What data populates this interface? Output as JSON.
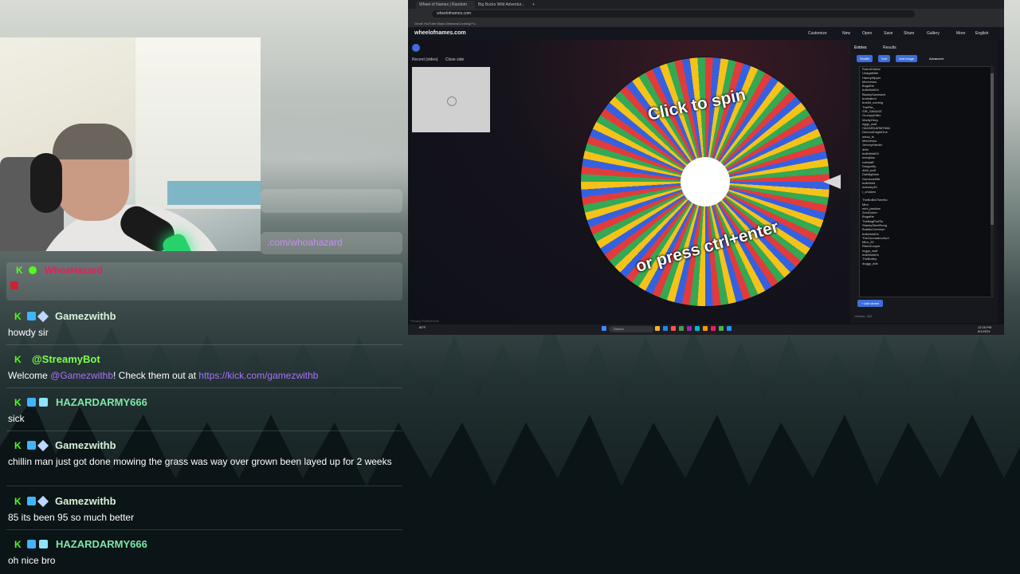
{
  "overlay": {
    "social_handle": ".com/whoahazard",
    "streamer_name": "WhoaHazard"
  },
  "chat": [
    {
      "user": "Gamezwithb",
      "user_color": "#d8f3d8",
      "text": "howdy sir"
    },
    {
      "user": "@StreamyBot",
      "user_color": "#7fff4f",
      "text_before": "Welcome ",
      "mention": "@Gamezwithb",
      "text_mid": "! Check them out at ",
      "link": "https://kick.com/gamezwithb"
    },
    {
      "user": "HAZARDARMY666",
      "user_color": "#7ee8a8",
      "text": "sick"
    },
    {
      "user": "Gamezwithb",
      "user_color": "#d8f3d8",
      "text": "chillin man just got done mowing the grass was way over grown been layed up for 2 weeks"
    },
    {
      "user": "Gamezwithb",
      "user_color": "#d8f3d8",
      "text": "85 its been 95 so much better"
    },
    {
      "user": "HAZARDARMY666",
      "user_color": "#7ee8a8",
      "text": "oh nice bro"
    }
  ],
  "browser": {
    "tabs": [
      "Wheel of Names | Random name...",
      "Big Bucks Wild Adventur...",
      "+"
    ],
    "url": "wheelofnames.com",
    "bookmarks": "Gmail   YouTube   Maps   DeliciousCooking Fu..."
  },
  "app": {
    "brand": "wheelofnames.com",
    "nav": [
      "Customize",
      "New",
      "Open",
      "Save",
      "Share",
      "Gallery",
      "More",
      "English"
    ],
    "recent_label": "Recent (video)",
    "close_label": "Close side",
    "footer": "Privacy Preferences",
    "wheel_text_top": "Click to spin",
    "wheel_text_bottom": "or press ctrl+enter",
    "panel_tabs": [
      "Entries",
      "Results"
    ],
    "panel_buttons": [
      "Shuffle",
      "Sort",
      "Add image",
      "Advanced"
    ],
    "entries": [
      "RobotOrbital",
      "Unagafeller",
      "HannyHipper",
      "Mechesso",
      "Bugathe",
      "bulletbird04",
      "BlankySandwich",
      "bubbatm4",
      "butdid_coming",
      "ThePile_",
      "SIR_SAVAGE",
      "GrumpyKiller",
      "MadlyOkey",
      "eggs_wolf",
      "HAZARDARMY666",
      "DemonKnightOne",
      "whoa_fs",
      "Mechesso",
      "JohnnyHarder",
      "dribl",
      "bulletbird04",
      "eeeqkiss",
      "ruthstaff",
      "Dragonfly",
      "dribl_wolf",
      "Darklightow",
      "Gamezwithb",
      "bulletbird",
      "mammy40",
      "r_chicken",
      "",
      "TheBoBisTheeNo",
      "Mira",
      "mini_jacktow",
      "ZeroDuker",
      "Bugathe",
      "TheBagProfSu",
      "StankySteelRung",
      "ButtdicCommon",
      "bulletbird04",
      "TheGunnaleLeNc3",
      "Mira_29",
      "ReedCooper",
      "mggo_wolf",
      "bulletbird04",
      "TheBobby",
      "doggy_dds"
    ],
    "add_wheel": "+ Add wheel",
    "panel_footer": "Version: 442",
    "taskbar_search": "Search",
    "taskbar_weather": "85°F",
    "taskbar_time": "12:25 PM",
    "taskbar_date": "6/1/2024"
  }
}
